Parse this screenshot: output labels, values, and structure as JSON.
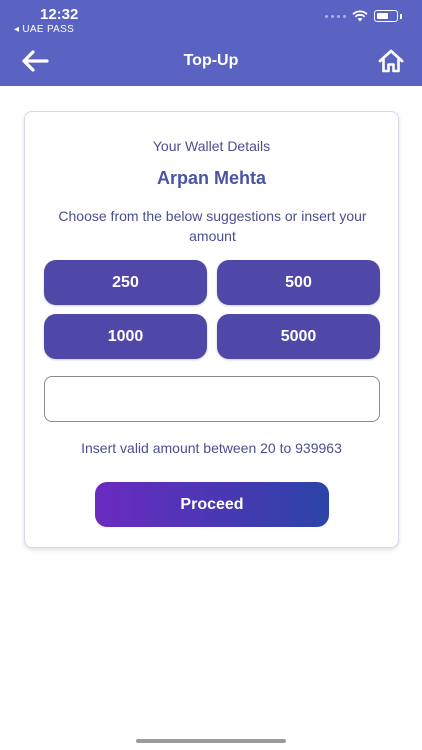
{
  "status_bar": {
    "time": "12:32",
    "back_app": "◂ UAE PASS"
  },
  "nav": {
    "title": "Top-Up",
    "back_icon": "arrow-left-icon",
    "home_icon": "home-icon"
  },
  "wallet": {
    "label": "Your Wallet Details",
    "name": "Arpan Mehta",
    "instruction": "Choose from the below suggestions or insert your amount"
  },
  "amounts": [
    "250",
    "500",
    "1000",
    "5000"
  ],
  "input": {
    "value": "",
    "placeholder": ""
  },
  "hint": "Insert valid amount between 20 to 939963",
  "proceed_label": "Proceed",
  "colors": {
    "header": "#5a63c2",
    "accent": "#5048a8",
    "gradient_start": "#6b2ac0",
    "gradient_end": "#2c44a8"
  }
}
